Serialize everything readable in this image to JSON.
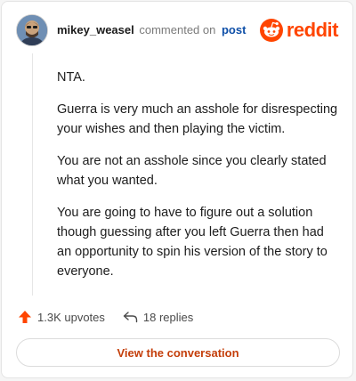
{
  "header": {
    "username": "mikey_weasel",
    "action_text": "commented on",
    "post_link": "post",
    "brand_name": "reddit"
  },
  "comment": {
    "paragraphs": [
      "NTA.",
      "Guerra is very much an asshole for disrespecting your wishes and then playing the victim.",
      "You are not an asshole since you clearly stated what you wanted.",
      "You are going to have to figure out a solution though guessing after you left Guerra then had an opportunity to spin his version of the story to everyone."
    ]
  },
  "actions": {
    "upvotes": "1.3K upvotes",
    "replies": "18 replies"
  },
  "cta": {
    "label": "View the conversation"
  },
  "colors": {
    "brand": "#ff4500",
    "link": "#0e4fa8",
    "cta_text": "#c43e0a"
  },
  "icons": [
    "avatar",
    "reddit-logo-icon",
    "upvote-arrow-icon",
    "reply-arrow-icon"
  ]
}
